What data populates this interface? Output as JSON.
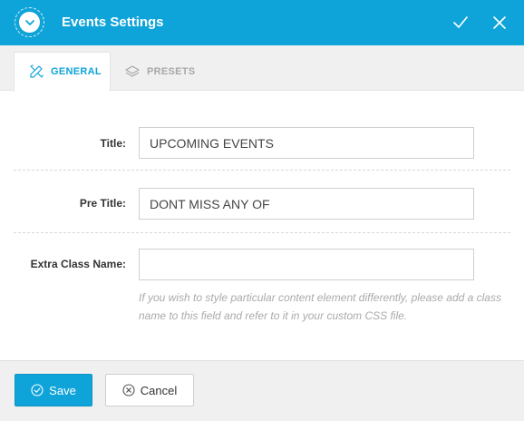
{
  "header": {
    "title": "Events Settings",
    "collapse_icon": "chevron-down-icon",
    "confirm_icon": "check-icon",
    "close_icon": "close-icon"
  },
  "tabs": [
    {
      "label": "GENERAL",
      "icon": "pencil-ruler-icon",
      "active": true
    },
    {
      "label": "PRESETS",
      "icon": "layers-icon",
      "active": false
    }
  ],
  "form": {
    "title": {
      "label": "Title:",
      "value": "UPCOMING EVENTS"
    },
    "pre_title": {
      "label": "Pre Title:",
      "value": "DONT MISS ANY OF"
    },
    "extra_class": {
      "label": "Extra Class Name:",
      "value": "",
      "help": "If you wish to style particular content element differently, please add a class name to this field and refer to it in your custom CSS file."
    }
  },
  "footer": {
    "save_label": "Save",
    "save_icon": "check-circle-icon",
    "cancel_label": "Cancel",
    "cancel_icon": "x-circle-icon"
  },
  "colors": {
    "accent": "#0fa4d9",
    "tab_bar": "#f0f0f0",
    "help_text": "#aaaaaa"
  }
}
